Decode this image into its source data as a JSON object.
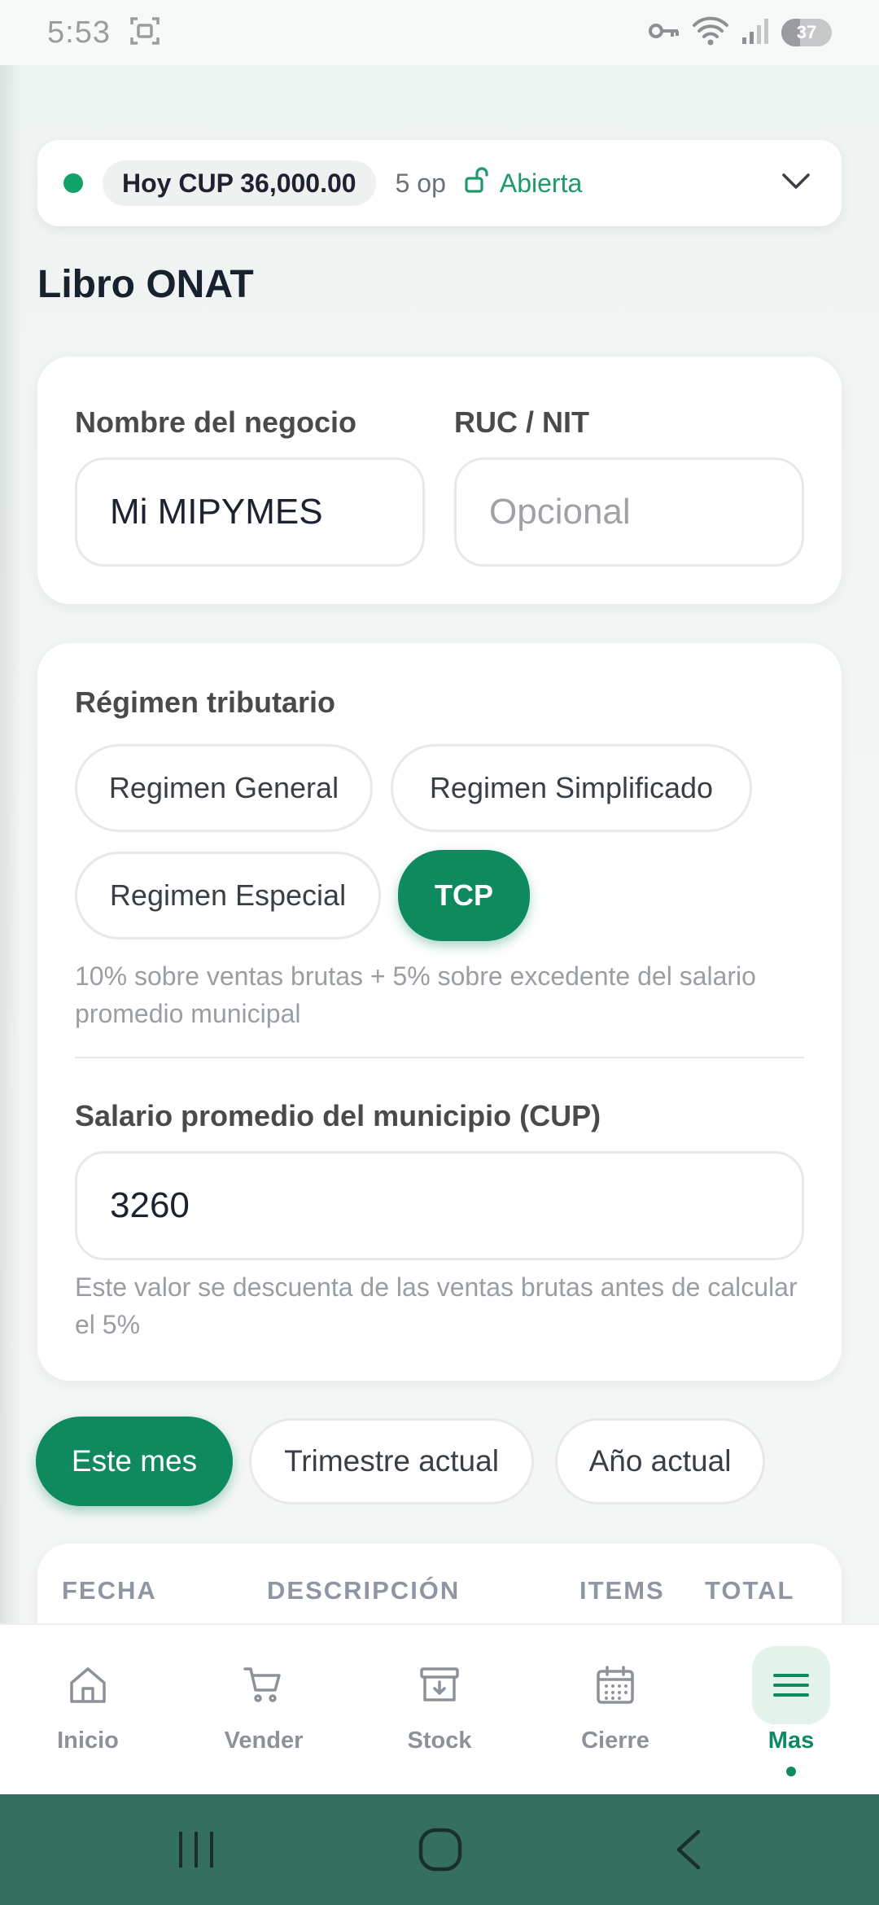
{
  "status_bar": {
    "time": "5:53",
    "battery": "37",
    "battery_level": 0.37
  },
  "session": {
    "today": "Hoy CUP 36,000.00",
    "ops": "5 op",
    "state": "Abierta"
  },
  "page": {
    "title": "Libro ONAT"
  },
  "business": {
    "name_label": "Nombre del negocio",
    "name_value": "Mi MIPYMES",
    "ruc_label": "RUC / NIT",
    "ruc_placeholder": "Opcional"
  },
  "regime": {
    "label": "Régimen tributario",
    "options": [
      "Regimen General",
      "Regimen Simplificado",
      "Regimen Especial",
      "TCP"
    ],
    "selected": "TCP",
    "description": "10% sobre ventas brutas + 5% sobre excedente del salario promedio municipal"
  },
  "salary": {
    "label": "Salario promedio del municipio (CUP)",
    "value": "3260",
    "hint": "Este valor se descuenta de las ventas brutas antes de calcular el 5%"
  },
  "periods": {
    "options": [
      "Este mes",
      "Trimestre actual",
      "Año actual"
    ],
    "selected": "Este mes"
  },
  "table": {
    "headers": [
      "FECHA",
      "DESCRIPCIÓN",
      "ITEMS",
      "TOTAL"
    ]
  },
  "nav": {
    "items": [
      {
        "label": "Inicio",
        "icon": "home-icon"
      },
      {
        "label": "Vender",
        "icon": "cart-icon"
      },
      {
        "label": "Stock",
        "icon": "archive-icon"
      },
      {
        "label": "Cierre",
        "icon": "calendar-icon"
      },
      {
        "label": "Mas",
        "icon": "menu-icon"
      }
    ],
    "active": "Mas"
  },
  "colors": {
    "accent": "#0f8a5e",
    "status_green": "#12a36b",
    "system_nav": "#356f5f"
  }
}
